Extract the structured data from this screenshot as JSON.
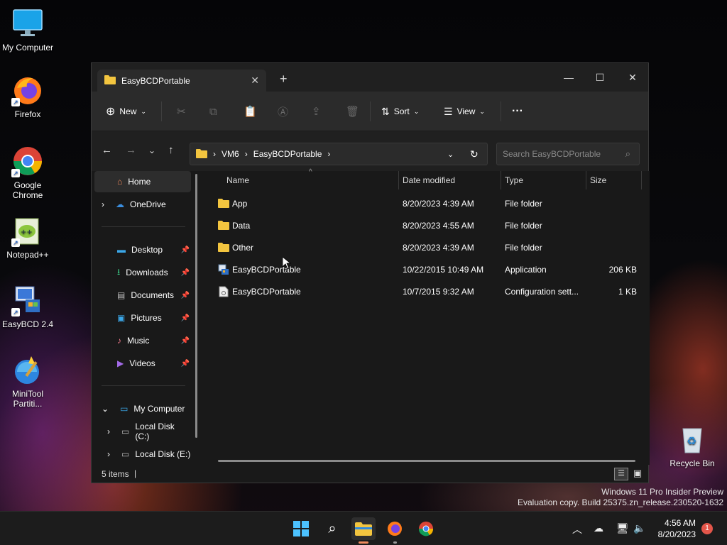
{
  "desktop": {
    "icons": [
      {
        "label": "My Computer"
      },
      {
        "label": "Firefox"
      },
      {
        "label": "Google Chrome"
      },
      {
        "label": "Notepad++"
      },
      {
        "label": "EasyBCD 2.4"
      },
      {
        "label": "MiniTool Partiti..."
      },
      {
        "label": "Recycle Bin"
      }
    ]
  },
  "window": {
    "tab_title": "EasyBCDPortable",
    "toolbar": {
      "new_label": "New",
      "sort_label": "Sort",
      "view_label": "View",
      "more_label": "···"
    },
    "address": {
      "crumbs": [
        "VM6",
        "EasyBCDPortable"
      ],
      "search_placeholder": "Search EasyBCDPortable"
    },
    "nav": {
      "home": "Home",
      "onedrive": "OneDrive",
      "quick": [
        "Desktop",
        "Downloads",
        "Documents",
        "Pictures",
        "Music",
        "Videos"
      ],
      "my_computer": "My Computer",
      "drives": [
        "Local Disk (C:)",
        "Local Disk (E:)"
      ]
    },
    "columns": {
      "name": "Name",
      "date": "Date modified",
      "type": "Type",
      "size": "Size"
    },
    "files": [
      {
        "name": "App",
        "date": "8/20/2023 4:39 AM",
        "type": "File folder",
        "size": "",
        "icon": "folder-icon"
      },
      {
        "name": "Data",
        "date": "8/20/2023 4:55 AM",
        "type": "File folder",
        "size": "",
        "icon": "folder-icon"
      },
      {
        "name": "Other",
        "date": "8/20/2023 4:39 AM",
        "type": "File folder",
        "size": "",
        "icon": "folder-icon"
      },
      {
        "name": "EasyBCDPortable",
        "date": "10/22/2015 10:49 AM",
        "type": "Application",
        "size": "206 KB",
        "icon": "application-icon"
      },
      {
        "name": "EasyBCDPortable",
        "date": "10/7/2015 9:32 AM",
        "type": "Configuration sett...",
        "size": "1 KB",
        "icon": "config-file-icon"
      }
    ],
    "status": {
      "count": "5 items"
    }
  },
  "watermark": {
    "line1": "Windows 11 Pro Insider Preview",
    "line2": "Evaluation copy. Build 25375.zn_release.230520-1632"
  },
  "taskbar": {
    "time": "4:56 AM",
    "date": "8/20/2023",
    "notifications": "1"
  },
  "colors": {
    "folder": "#f3c53f",
    "accent": "#4cc2ff",
    "window_bg": "#191919"
  }
}
